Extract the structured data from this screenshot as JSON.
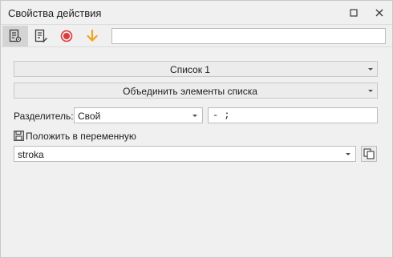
{
  "window": {
    "title": "Свойства действия"
  },
  "toolbar": {
    "buttons": [
      {
        "icon": "properties-icon",
        "active": true
      },
      {
        "icon": "notes-icon",
        "active": false
      },
      {
        "icon": "record-icon",
        "color": "#e0383e"
      },
      {
        "icon": "arrow-down-icon",
        "color": "#f0a418"
      }
    ],
    "input_value": ""
  },
  "form": {
    "list_select": "Список 1",
    "operation_select": "Объединить элементы списка",
    "separator_label": "Разделитель:",
    "separator_type": "Свой",
    "separator_value": "- ;",
    "save_to_var_label": "Положить в переменную",
    "variable_value": "stroka"
  }
}
